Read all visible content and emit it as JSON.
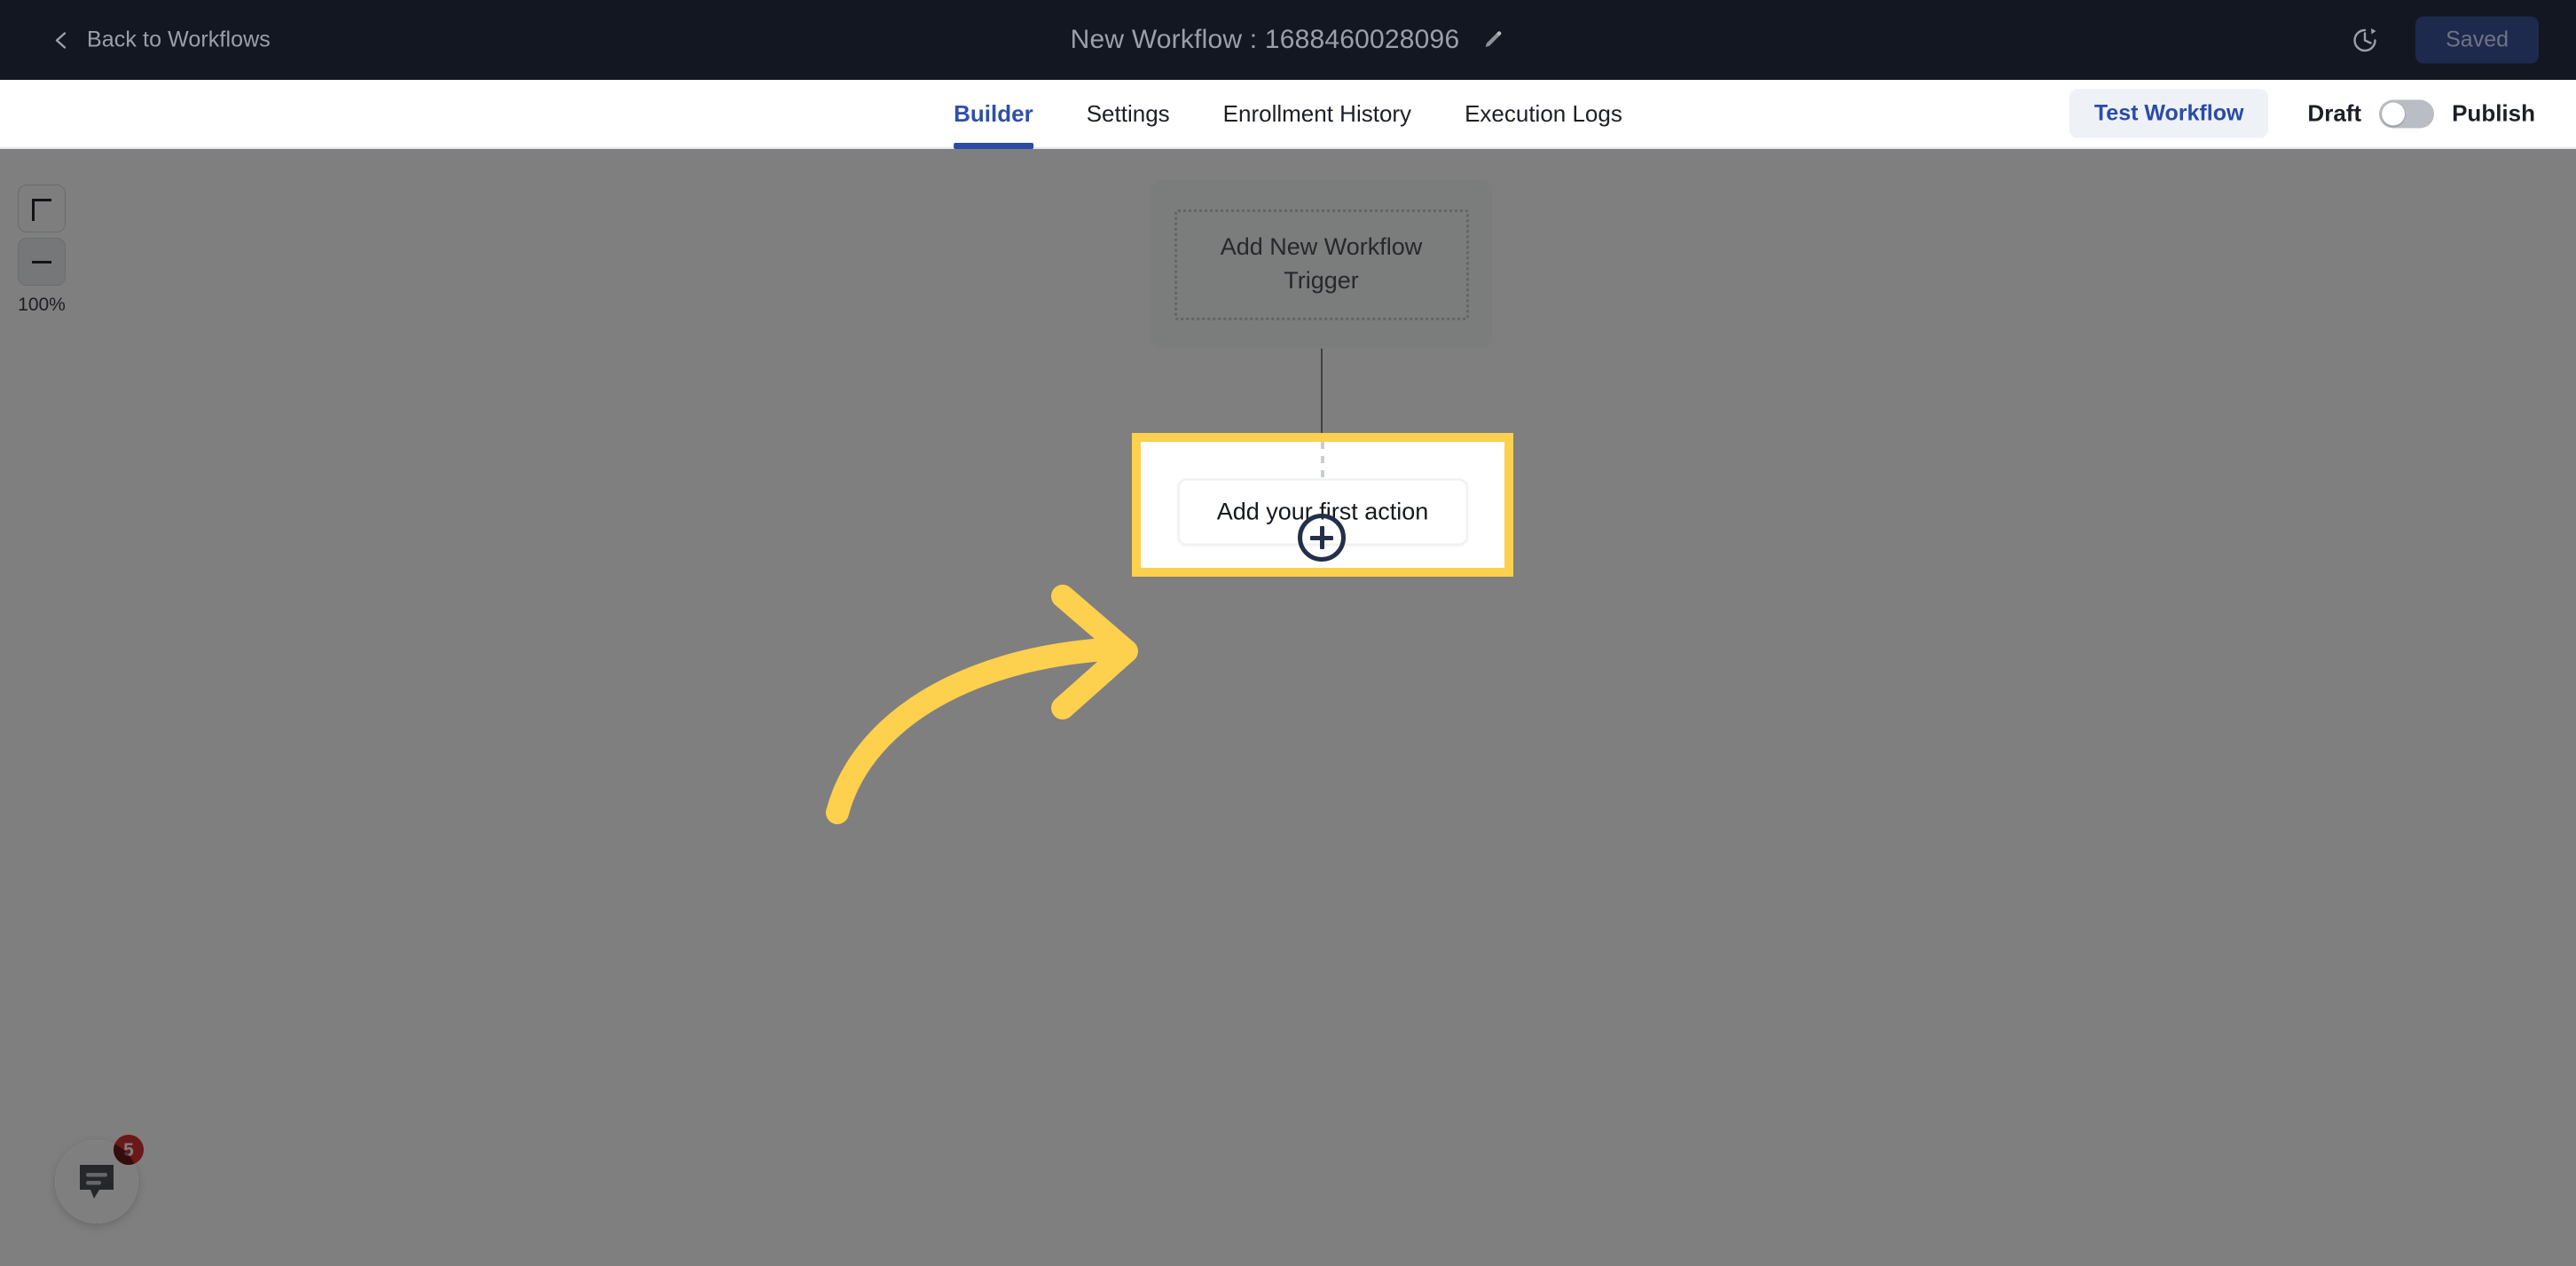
{
  "header": {
    "back_label": "Back to Workflows",
    "back_icon": "chevron-left-icon",
    "title": "New Workflow : 1688460028096",
    "edit_icon": "pencil-icon",
    "history_icon": "clock-history-icon",
    "saved_label": "Saved",
    "bg_color": "#121722",
    "saved_bg_color": "#1d2a4e"
  },
  "tabbar": {
    "tabs": [
      {
        "label": "Builder",
        "active": true
      },
      {
        "label": "Settings",
        "active": false
      },
      {
        "label": "Enrollment History",
        "active": false
      },
      {
        "label": "Execution Logs",
        "active": false
      }
    ],
    "test_workflow_label": "Test Workflow",
    "draft_label": "Draft",
    "publish_label": "Publish",
    "toggle_state": "off",
    "accent_color": "#2b4ba5"
  },
  "canvas": {
    "zoom": {
      "plus_icon": "plus-icon",
      "minus_icon": "minus-icon",
      "level": "100%"
    },
    "trigger_node": {
      "label": "Add New Workflow Trigger"
    },
    "add_step_icon": "plus-circle-icon",
    "action_node": {
      "label": "Add your first action"
    },
    "highlight_color": "#fdd04d",
    "annotation_arrow": {
      "icon": "curved-arrow-right-icon",
      "color": "#fdd04d"
    },
    "chat_widget": {
      "icon": "chat-bubble-icon",
      "badge_count": "5",
      "badge_color": "#d63031"
    }
  }
}
